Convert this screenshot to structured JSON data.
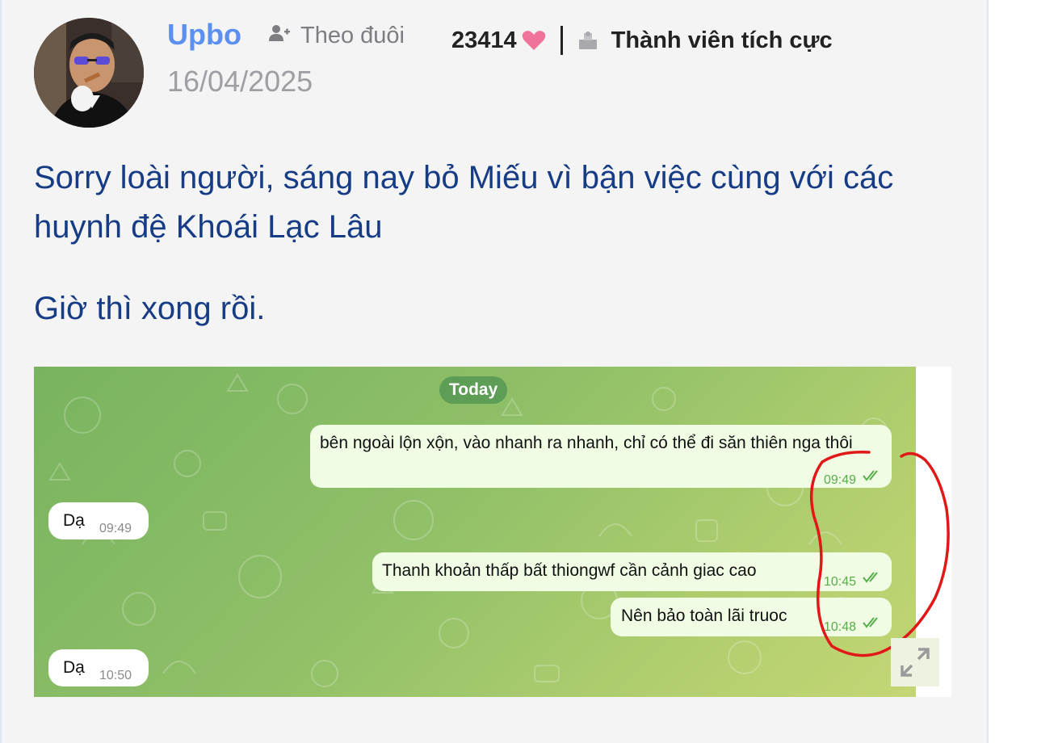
{
  "post": {
    "author": "Upbo",
    "follow_label": "Theo đuôi",
    "date": "16/04/2025",
    "likes": "23414",
    "rank": "Thành viên tích cực",
    "text_line1": "Sorry loài người, sáng nay bỏ Miếu vì bận việc cùng với các huynh đệ Khoái Lạc Lâu",
    "text_line2": "Giờ thì xong rồi."
  },
  "chat": {
    "date_chip": "Today",
    "messages": [
      {
        "direction": "out",
        "text": "bên ngoài lộn xộn, vào nhanh ra nhanh, chỉ có thể đi săn thiên nga thôi",
        "time": "09:49"
      },
      {
        "direction": "in",
        "text": "Dạ",
        "time": "09:49"
      },
      {
        "direction": "out",
        "text": "Thanh khoản thấp bất thiongwf cần cảnh giac cao",
        "time": "10:45"
      },
      {
        "direction": "out",
        "text": "Nên bảo toàn lãi truoc",
        "time": "10:48"
      },
      {
        "direction": "in",
        "text": "Dạ",
        "time": "10:50"
      }
    ]
  },
  "colors": {
    "username": "#5b8ff0",
    "post_text": "#173c86",
    "heart": "#f0739a",
    "annotation": "#e01818"
  },
  "icons": [
    "follow-user-icon",
    "heart-icon",
    "rank-icon",
    "expand-icon",
    "double-check-icon"
  ]
}
